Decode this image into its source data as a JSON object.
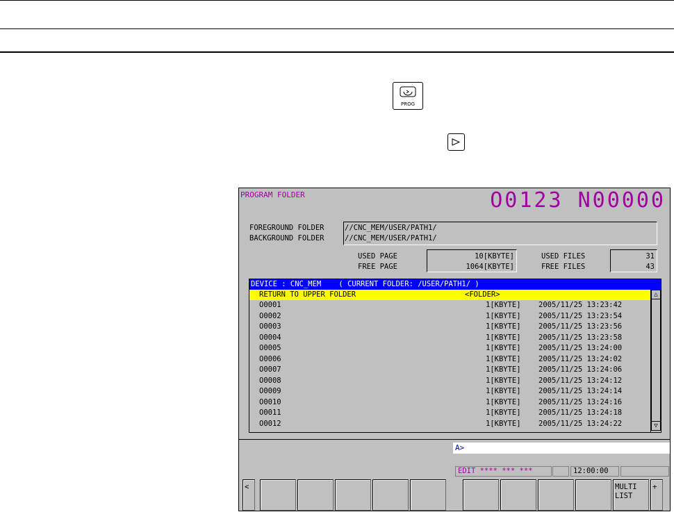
{
  "keys": {
    "prog_label": "PROG",
    "prog_icon": "prog-icon",
    "next_icon": "triangle-right-icon"
  },
  "screen": {
    "title": "PROGRAM FOLDER",
    "program_number": "O0123 N00000",
    "foreground_label": "FOREGROUND FOLDER",
    "foreground_value": "//CNC_MEM/USER/PATH1/",
    "background_label": "BACKGROUND FOLDER",
    "background_value": "//CNC_MEM/USER/PATH1/",
    "used_page_label": "USED PAGE",
    "used_page_value": "10[KBYTE]",
    "free_page_label": "FREE PAGE",
    "free_page_value": "1064[KBYTE]",
    "used_files_label": "USED FILES",
    "used_files_value": "31",
    "free_files_label": "FREE FILES",
    "free_files_value": "43",
    "list_header": "DEVICE : CNC_MEM    ( CURRENT FOLDER: /USER/PATH1/ )",
    "upper_folder_label": "RETURN TO UPPER FOLDER",
    "upper_folder_type": "<FOLDER>",
    "files": [
      {
        "name": "O0001",
        "size": "1[KBYTE]",
        "date": "2005/11/25 13:23:42"
      },
      {
        "name": "O0002",
        "size": "1[KBYTE]",
        "date": "2005/11/25 13:23:54"
      },
      {
        "name": "O0003",
        "size": "1[KBYTE]",
        "date": "2005/11/25 13:23:56"
      },
      {
        "name": "O0004",
        "size": "1[KBYTE]",
        "date": "2005/11/25 13:23:58"
      },
      {
        "name": "O0005",
        "size": "1[KBYTE]",
        "date": "2005/11/25 13:24:00"
      },
      {
        "name": "O0006",
        "size": "1[KBYTE]",
        "date": "2005/11/25 13:24:02"
      },
      {
        "name": "O0007",
        "size": "1[KBYTE]",
        "date": "2005/11/25 13:24:06"
      },
      {
        "name": "O0008",
        "size": "1[KBYTE]",
        "date": "2005/11/25 13:24:12"
      },
      {
        "name": "O0009",
        "size": "1[KBYTE]",
        "date": "2005/11/25 13:24:14"
      },
      {
        "name": "O0010",
        "size": "1[KBYTE]",
        "date": "2005/11/25 13:24:16"
      },
      {
        "name": "O0011",
        "size": "1[KBYTE]",
        "date": "2005/11/25 13:24:18"
      },
      {
        "name": "O0012",
        "size": "1[KBYTE]",
        "date": "2005/11/25 13:24:22"
      }
    ],
    "scroll_up": "△",
    "scroll_down": "▽",
    "prompt": "A>",
    "mode": "EDIT **** *** ***",
    "time": "12:00:00",
    "softkey_left": "<",
    "softkey_right": "+",
    "softkey_multi_list": "MULTI\nLIST"
  },
  "colors": {
    "title": "#a000a0",
    "header_bg": "#0000ff",
    "selected_bg": "#ffff00",
    "screen_bg": "#c0c0c0"
  }
}
